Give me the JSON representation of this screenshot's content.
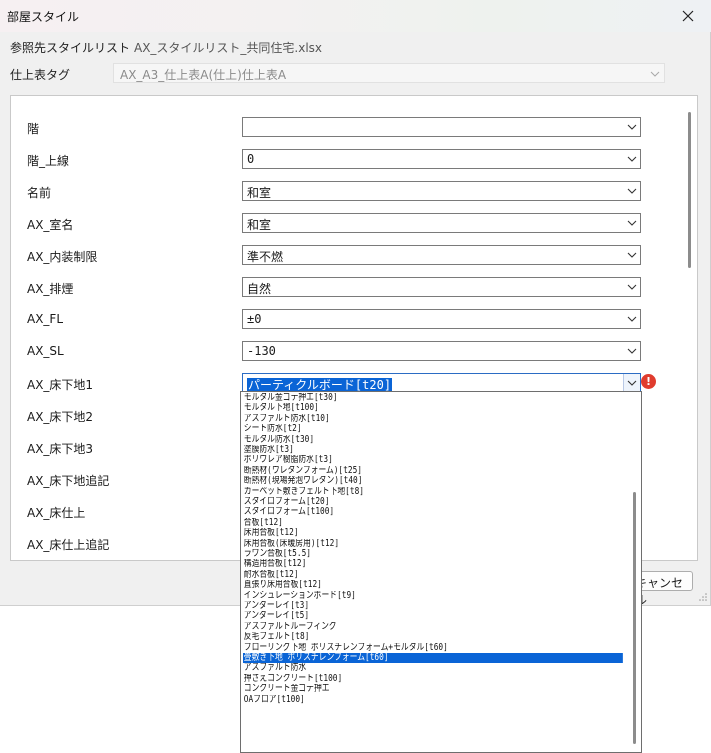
{
  "window": {
    "title": "部屋スタイル"
  },
  "header": {
    "ref_label": "参照先スタイルリスト",
    "ref_value": "AX_スタイルリスト_共同住宅.xlsx",
    "tag_label": "仕上表タグ",
    "tag_value": "AX_A3_仕上表A(仕上)仕上表A"
  },
  "fields": [
    {
      "label": "階",
      "value": ""
    },
    {
      "label": "階_上線",
      "value": "0"
    },
    {
      "label": "名前",
      "value": "和室"
    },
    {
      "label": "AX_室名",
      "value": "和室"
    },
    {
      "label": "AX_内装制限",
      "value": "準不燃"
    },
    {
      "label": "AX_排煙",
      "value": "自然"
    },
    {
      "label": "AX_FL",
      "value": "±0"
    },
    {
      "label": "AX_SL",
      "value": "-130"
    },
    {
      "label": "AX_床下地1",
      "value": "パーティクルボード[t20]"
    },
    {
      "label": "AX_床下地2",
      "value": ""
    },
    {
      "label": "AX_床下地3",
      "value": ""
    },
    {
      "label": "AX_床下地追記",
      "value": ""
    },
    {
      "label": "AX_床仕上",
      "value": ""
    },
    {
      "label": "AX_床仕上追記",
      "value": ""
    }
  ],
  "dropdown": {
    "items": [
      "モルタル金ゴテ押エ[t30]",
      "モルタル下地[t100]",
      "アスファルト防水[t10]",
      "シート防水[t2]",
      "モルタル防水[t30]",
      "塗膜防水[t3]",
      "ポリウレア樹脂防水[t3]",
      "断熱材(ウレタンフォーム)[t25]",
      "断熱材(現場発泡ウレタン)[t40]",
      "カーペット敷きフェルト下地[t8]",
      "スタイロフォーム[t20]",
      "スタイロフォーム[t100]",
      "合板[t12]",
      "床用合板[t12]",
      "床用合板(床暖房用)[t12]",
      "ラワン合板[t5.5]",
      "構造用合板[t12]",
      "耐水合板[t12]",
      "直張り床用合板[t12]",
      "インシュレーションボード[t9]",
      "アンダーレイ[t3]",
      "アンダーレイ[t5]",
      "アスファルトルーフィング",
      "反毛フェルト[t8]",
      "フローリング下地 ポリスチレンフォーム+モルタル[t60]",
      "畳敷き下地 ポリスチレンフォーム[t60]",
      "アスファルト防水",
      "押さえコンクリート[t100]",
      "コンクリート金ゴテ押エ",
      "OAフロア[t100]"
    ]
  },
  "footer": {
    "cancel_label": "キャンセル"
  },
  "icons": {
    "close": "close-icon",
    "error": "error-icon",
    "chevron": "chevron-down-icon",
    "grip": "resize-grip-icon"
  },
  "colors": {
    "selection": "#0a64d6",
    "error": "#e03c2e"
  }
}
